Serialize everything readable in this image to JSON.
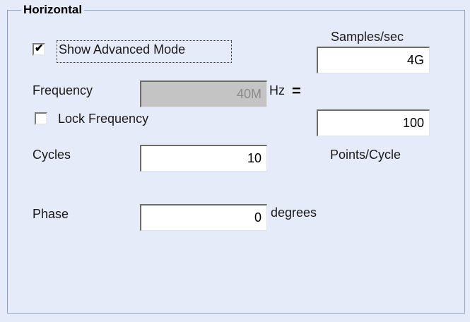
{
  "group": {
    "title": "Horizontal"
  },
  "advanced_mode": {
    "label": "Show Advanced Mode",
    "checked": true
  },
  "lock_frequency": {
    "label": "Lock Frequency",
    "checked": false
  },
  "frequency": {
    "label": "Frequency",
    "value": "40M",
    "unit": "Hz",
    "enabled": false
  },
  "cycles": {
    "label": "Cycles",
    "value": "10"
  },
  "phase": {
    "label": "Phase",
    "value": "0",
    "unit": "degrees"
  },
  "equals": "=",
  "samples_per_sec": {
    "label": "Samples/sec",
    "value": "4G"
  },
  "points_per_cycle": {
    "label": "Points/Cycle",
    "value": "100"
  }
}
